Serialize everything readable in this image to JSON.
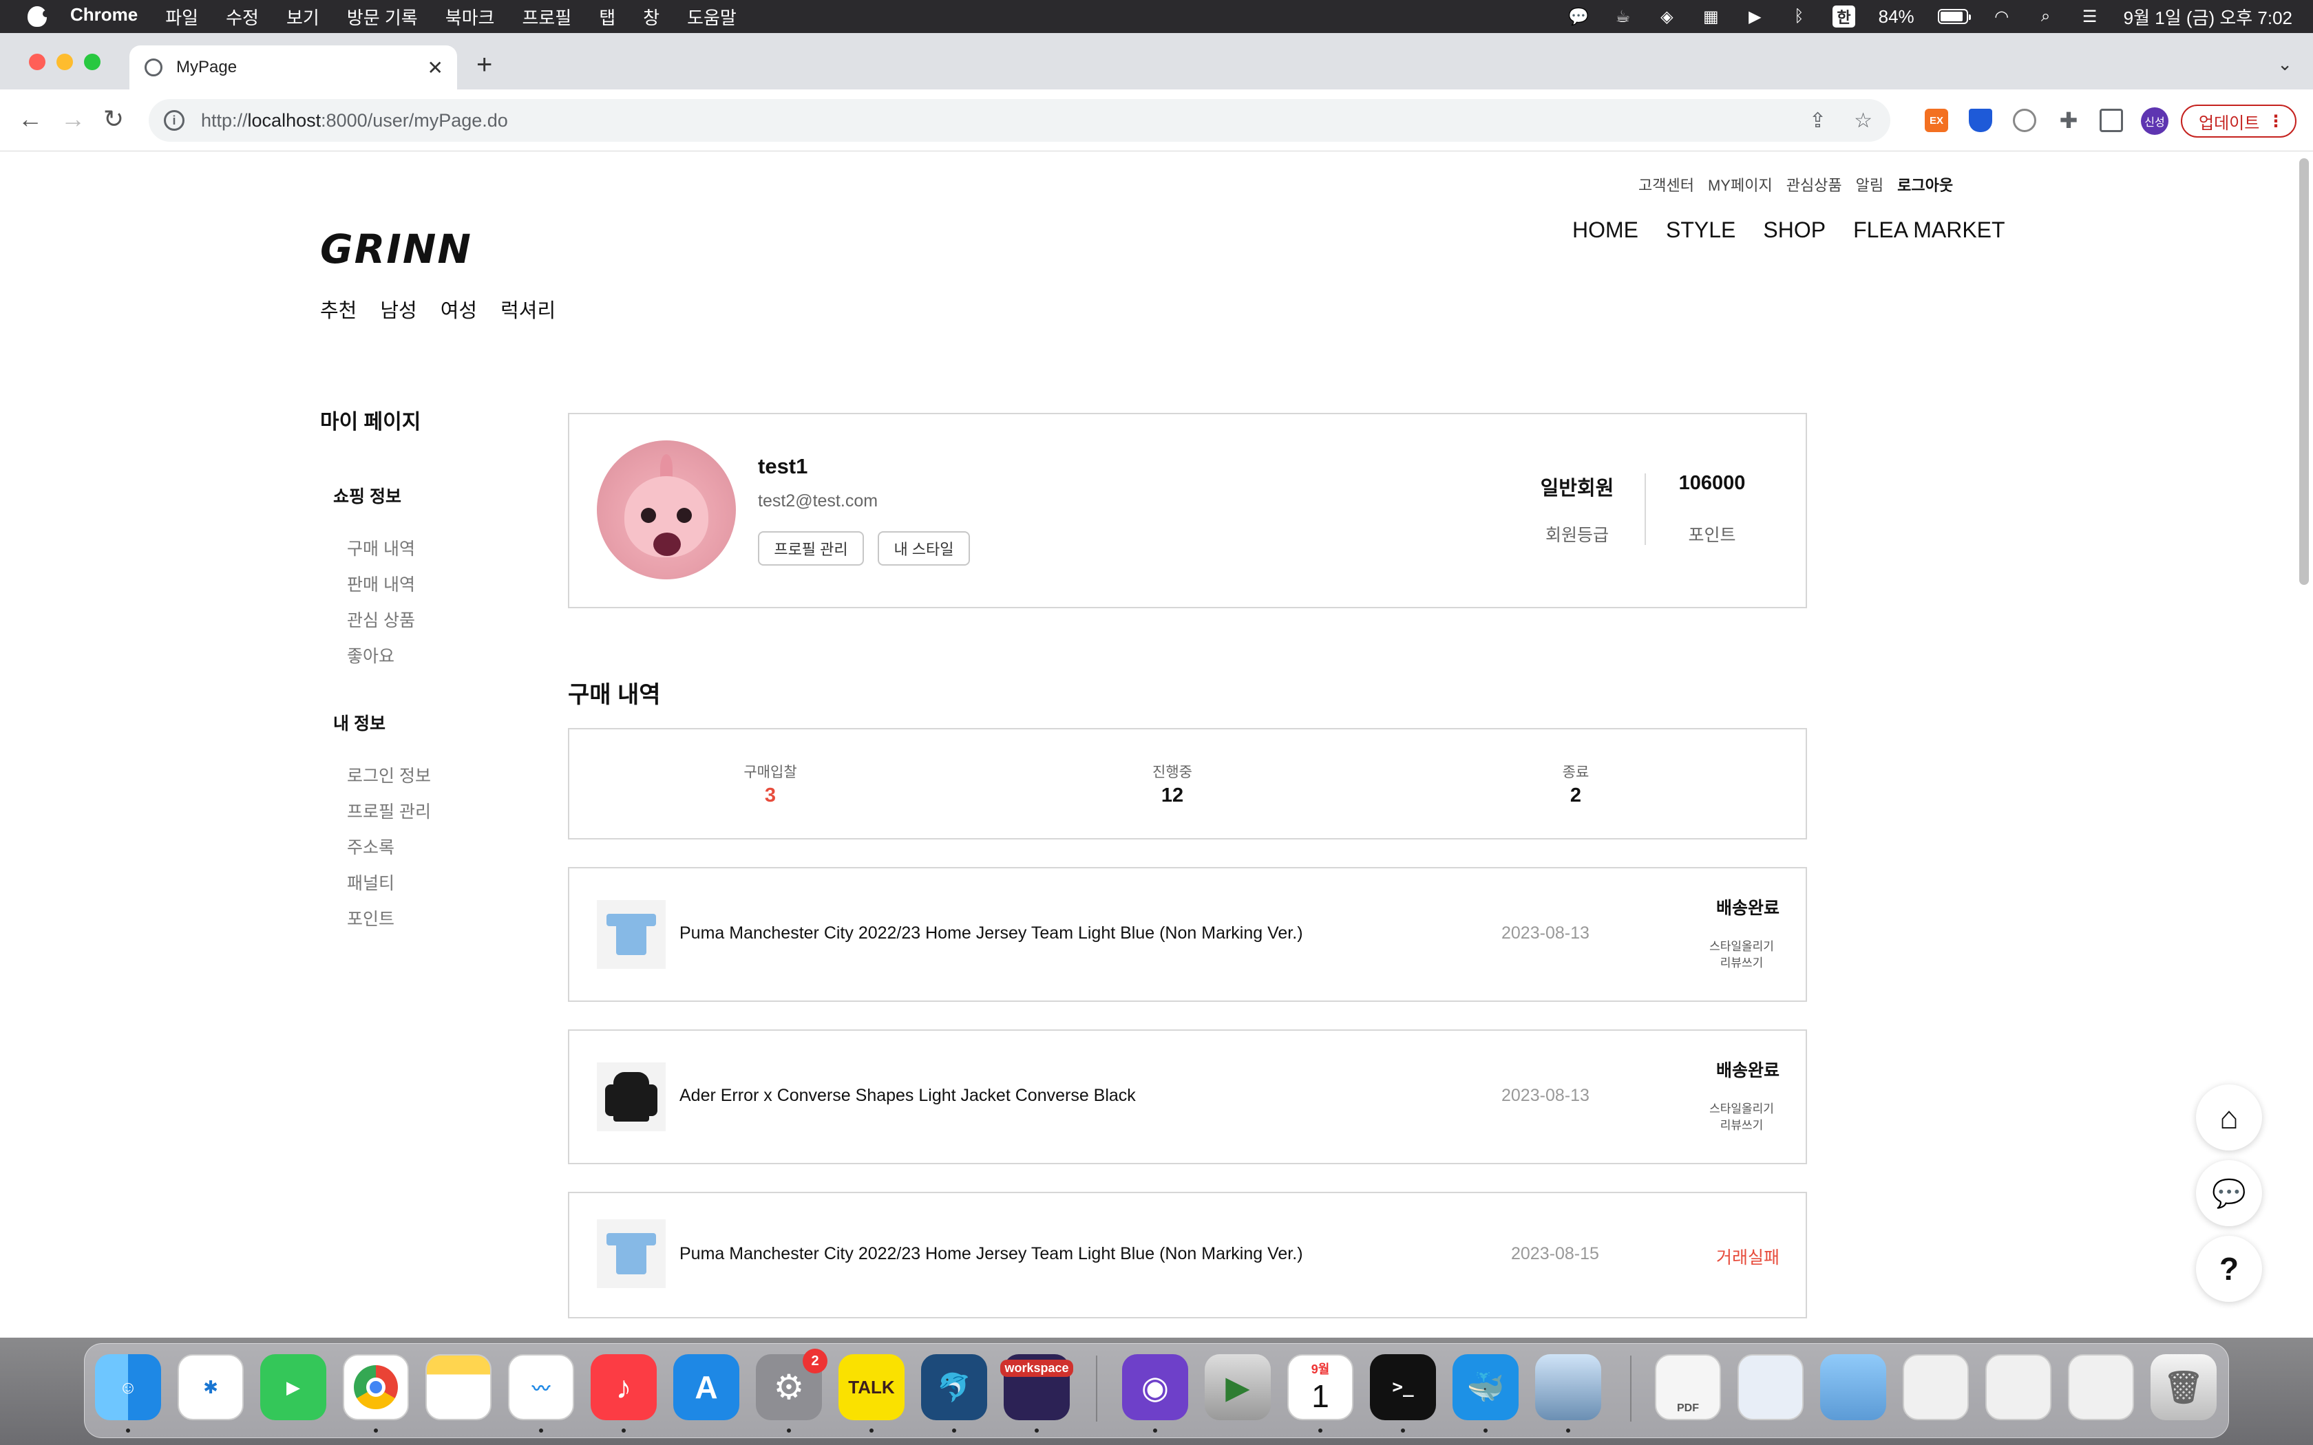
{
  "menubar": {
    "app_name": "Chrome",
    "items": [
      "파일",
      "수정",
      "보기",
      "방문 기록",
      "북마크",
      "프로필",
      "탭",
      "창",
      "도움말"
    ],
    "ime": "한",
    "battery": "84%",
    "clock": "9월 1일 (금) 오후 7:02"
  },
  "browser": {
    "tab_title": "MyPage",
    "url_scheme": "http://",
    "url_host": "localhost",
    "url_path": ":8000/user/myPage.do",
    "ext_ex_label": "EX",
    "profile_label": "신성",
    "update_label": "업데이트"
  },
  "site": {
    "logo": "GRINN",
    "util_links": [
      "고객센터",
      "MY페이지",
      "관심상품",
      "알림",
      "로그아웃"
    ],
    "main_nav": [
      "HOME",
      "STYLE",
      "SHOP",
      "FLEA MARKET"
    ],
    "cat_nav": [
      "추천",
      "남성",
      "여성",
      "럭셔리"
    ]
  },
  "sidebar": {
    "title": "마이 페이지",
    "group1": {
      "title": "쇼핑 정보",
      "items": [
        "구매 내역",
        "판매 내역",
        "관심 상품",
        "좋아요"
      ]
    },
    "group2": {
      "title": "내 정보",
      "items": [
        "로그인 정보",
        "프로필 관리",
        "주소록",
        "패널티",
        "포인트"
      ]
    }
  },
  "profile": {
    "name": "test1",
    "email": "test2@test.com",
    "btn_profile": "프로필 관리",
    "btn_style": "내 스타일",
    "grade_value": "일반회원",
    "grade_label": "회원등급",
    "point_value": "106000",
    "point_label": "포인트"
  },
  "purchase": {
    "title": "구매 내역",
    "stats": [
      {
        "label": "구매입찰",
        "value": "3"
      },
      {
        "label": "진행중",
        "value": "12"
      },
      {
        "label": "종료",
        "value": "2"
      }
    ],
    "orders": [
      {
        "name": "Puma Manchester City 2022/23 Home Jersey Team Light Blue (Non Marking Ver.)",
        "date": "2023-08-13",
        "status": "배송완료",
        "link1": "스타일올리기",
        "link2": "리뷰쓰기"
      },
      {
        "name": "Ader Error x Converse Shapes Light Jacket Converse Black",
        "date": "2023-08-13",
        "status": "배송완료",
        "link1": "스타일올리기",
        "link2": "리뷰쓰기"
      },
      {
        "name": "Puma Manchester City 2022/23 Home Jersey Team Light Blue (Non Marking Ver.)",
        "date": "2023-08-15",
        "status": "거래실패"
      }
    ]
  },
  "dock": {
    "settings_badge": "2",
    "kakao_label": "TALK",
    "workspace_label": "workspace",
    "calendar_month": "9월",
    "calendar_day": "1",
    "terminal_label": ">_",
    "pdf_label": "PDF"
  }
}
